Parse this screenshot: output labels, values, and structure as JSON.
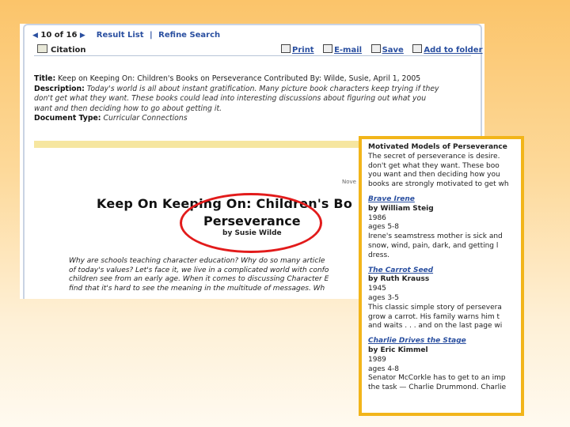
{
  "nav": {
    "position": "10 of 16",
    "result_list": "Result List",
    "separator": "|",
    "refine_search": "Refine Search"
  },
  "citation_label": "Citation",
  "tools": {
    "print": "Print",
    "email": "E-mail",
    "save": "Save",
    "add_to_folder": "Add to folder"
  },
  "record": {
    "title_label": "Title:",
    "title_value": "Keep on Keeping On: Children's Books on Perseverance Contributed By: Wilde, Susie, April 1, 2005",
    "description_label": "Description:",
    "description_lines": [
      "Today's world is all about instant gratification. Many picture book characters keep trying if they",
      "don't get what they want. These books could lead into interesting discussions about figuring out what you",
      "want and then deciding how to go about getting it."
    ],
    "doctype_label": "Document Type:",
    "doctype_value": "Curricular Connections"
  },
  "article": {
    "nov_label": "Nove",
    "title_line1": "Keep On Keeping On: Children's Bo",
    "title_line2": "Perseverance",
    "byline": "by Susie Wilde",
    "intro_lines": [
      "Why are schools teaching character education? Why do so many article",
      "of today's values? Let's face it, we live in a complicated world with confo",
      "children see from an early age. When it comes to discussing Character E",
      "find that it's hard to see the meaning in the multitude of messages. Wh"
    ]
  },
  "inset": {
    "heading": "Motivated Models of Perseverance",
    "intro_lines": [
      "The secret of perseverance is desire.",
      "don't get what they want. These boo",
      "you want and then deciding how you",
      "books are strongly motivated to get wh"
    ],
    "books": [
      {
        "title": "Brave Irene",
        "author": "by William Steig",
        "year": "1986",
        "ages": "ages 5-8",
        "lines": [
          "Irene's seamstress mother is sick and",
          "snow, wind, pain, dark, and getting l",
          "dress."
        ]
      },
      {
        "title": "The Carrot Seed",
        "author": "by Ruth Krauss",
        "year": "1945",
        "ages": "ages 3-5",
        "lines": [
          "This classic simple story of persevera",
          "grow a carrot. His family warns him t",
          "and waits . . . and on the last page wi"
        ]
      },
      {
        "title": "Charlie Drives the Stage",
        "author": "by Eric Kimmel",
        "year": "1989",
        "ages": "ages 4-8",
        "lines": [
          "Senator McCorkle has to get to an imp",
          "the task — Charlie Drummond. Charlie"
        ]
      }
    ]
  },
  "colors": {
    "link": "#2a4fa0",
    "highlight_ellipse": "#e21b1b",
    "inset_border": "#f2b51a"
  }
}
